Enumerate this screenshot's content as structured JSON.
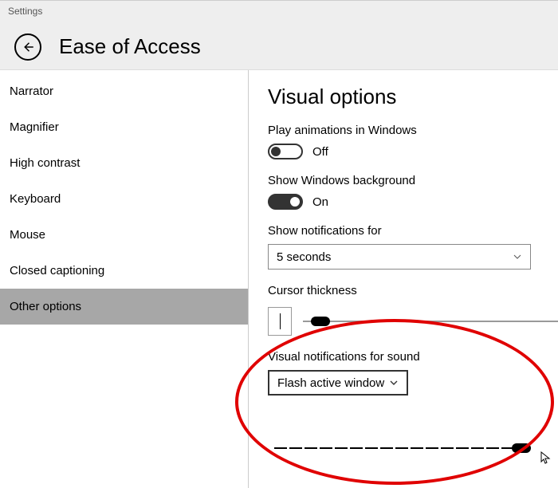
{
  "window": {
    "title": "Settings"
  },
  "header": {
    "title": "Ease of Access"
  },
  "sidebar": {
    "items": [
      {
        "label": "Narrator"
      },
      {
        "label": "Magnifier"
      },
      {
        "label": "High contrast"
      },
      {
        "label": "Keyboard"
      },
      {
        "label": "Mouse"
      },
      {
        "label": "Closed captioning"
      },
      {
        "label": "Other options"
      }
    ],
    "selected": 6
  },
  "main": {
    "title": "Visual options",
    "play_animations": {
      "label": "Play animations in Windows",
      "state": "Off"
    },
    "background": {
      "label": "Show Windows background",
      "state": "On"
    },
    "notifications": {
      "label": "Show notifications for",
      "value": "5 seconds"
    },
    "cursor_thickness": {
      "label": "Cursor thickness"
    },
    "visual_notifications": {
      "label": "Visual notifications for sound",
      "value": "Flash active window"
    }
  }
}
